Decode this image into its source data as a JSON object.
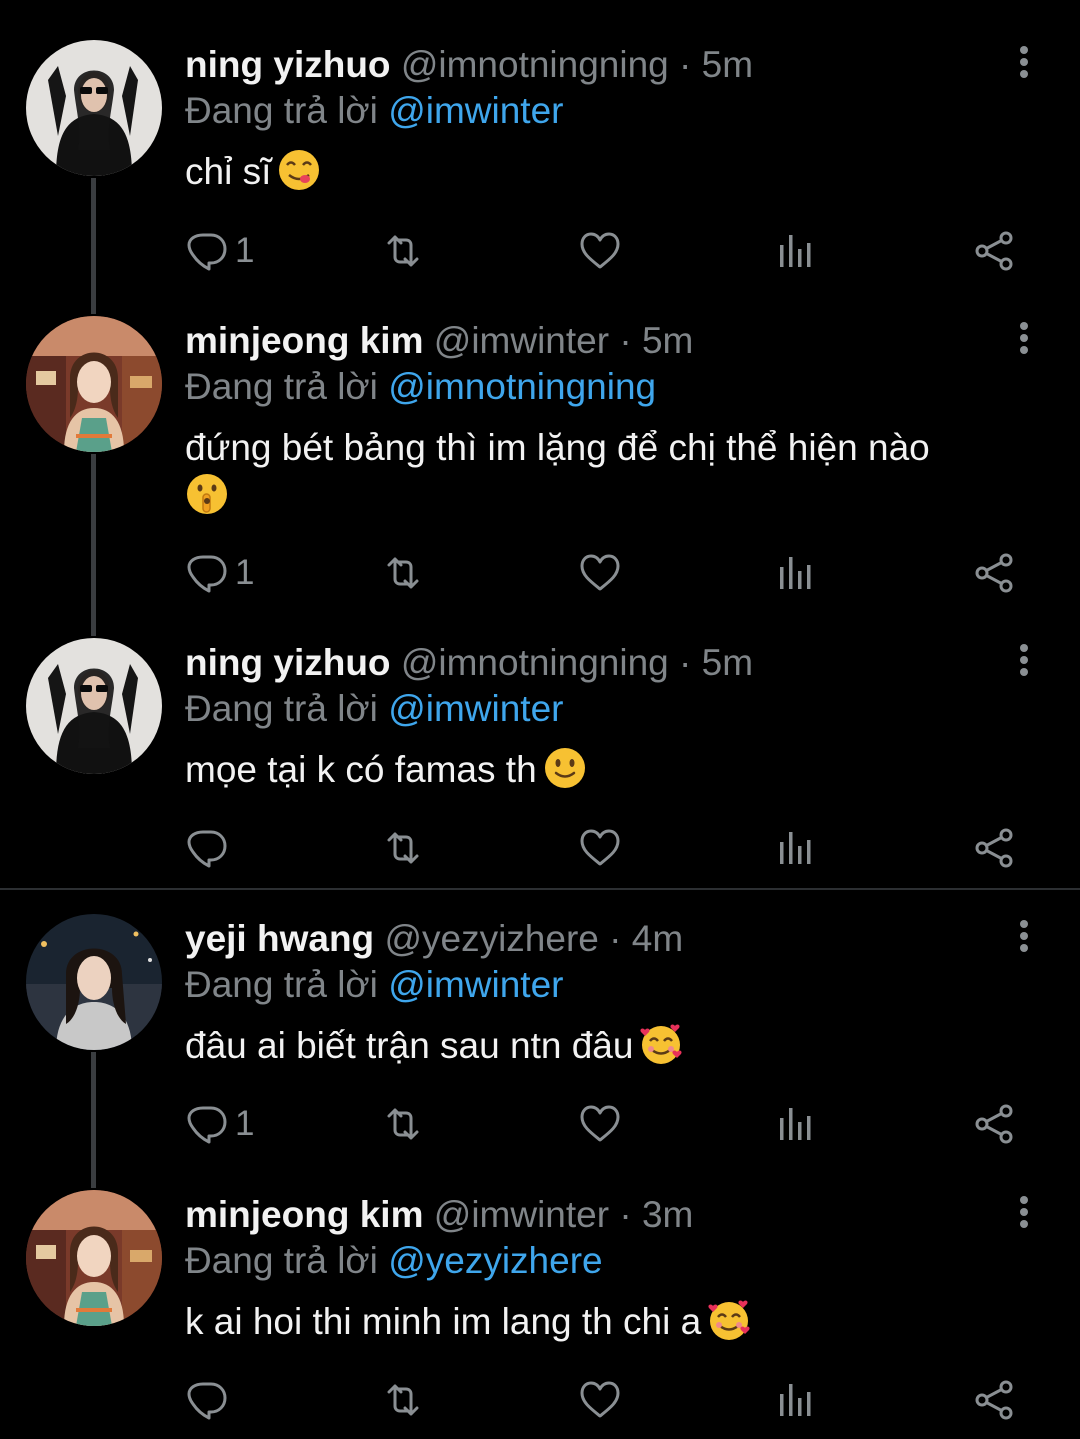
{
  "reply_prefix": "Đang trả lời",
  "colors": {
    "background": "#000000",
    "mention": "#3fa6ec",
    "muted": "#808589",
    "name": "#f2f2f2"
  },
  "tweets": [
    {
      "name": "ning yizhuo",
      "handle": "@imnotningning",
      "separator": "·",
      "time": "5m",
      "reply_to": "@imwinter",
      "text": "chỉ sĩ",
      "emoji": "face-savoring-food",
      "reply_count": "1",
      "retweet_count": "",
      "like_count": "",
      "avatar": "ning-avatar"
    },
    {
      "name": "minjeong kim",
      "handle": "@imwinter",
      "separator": "·",
      "time": "5m",
      "reply_to": "@imnotningning",
      "text": "đứng bét bảng thì im lặng để chị thể hiện nào",
      "emoji": "shushing-face",
      "reply_count": "1",
      "retweet_count": "",
      "like_count": "",
      "avatar": "winter-avatar"
    },
    {
      "name": "ning yizhuo",
      "handle": "@imnotningning",
      "separator": "·",
      "time": "5m",
      "reply_to": "@imwinter",
      "text": "mọe tại k có famas th",
      "emoji": "slightly-smiling-face",
      "reply_count": "",
      "retweet_count": "",
      "like_count": "",
      "avatar": "ning-avatar"
    },
    {
      "name": "yeji hwang",
      "handle": "@yezyizhere",
      "separator": "·",
      "time": "4m",
      "reply_to": "@imwinter",
      "text": "đâu ai biết trận sau ntn đâu",
      "emoji": "smiling-face-with-hearts",
      "reply_count": "1",
      "retweet_count": "",
      "like_count": "",
      "avatar": "yeji-avatar"
    },
    {
      "name": "minjeong kim",
      "handle": "@imwinter",
      "separator": "·",
      "time": "3m",
      "reply_to": "@yezyizhere",
      "text": "k ai hoi thi minh im lang th chi a",
      "emoji": "smiling-face-with-hearts",
      "reply_count": "",
      "retweet_count": "",
      "like_count": "",
      "avatar": "winter-avatar"
    }
  ]
}
